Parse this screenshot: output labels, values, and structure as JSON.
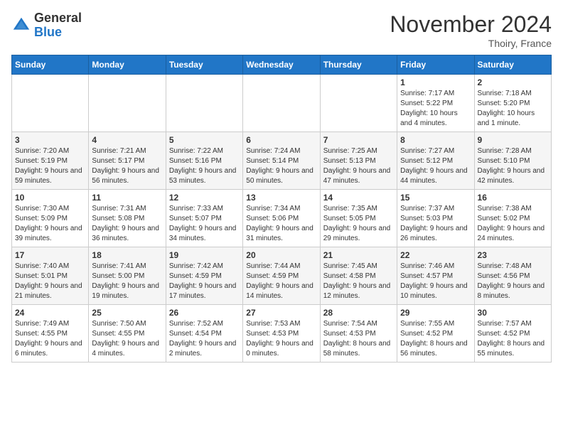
{
  "header": {
    "logo_general": "General",
    "logo_blue": "Blue",
    "month_title": "November 2024",
    "location": "Thoiry, France"
  },
  "weekdays": [
    "Sunday",
    "Monday",
    "Tuesday",
    "Wednesday",
    "Thursday",
    "Friday",
    "Saturday"
  ],
  "weeks": [
    [
      {
        "day": "",
        "info": ""
      },
      {
        "day": "",
        "info": ""
      },
      {
        "day": "",
        "info": ""
      },
      {
        "day": "",
        "info": ""
      },
      {
        "day": "",
        "info": ""
      },
      {
        "day": "1",
        "info": "Sunrise: 7:17 AM\nSunset: 5:22 PM\nDaylight: 10 hours and 4 minutes."
      },
      {
        "day": "2",
        "info": "Sunrise: 7:18 AM\nSunset: 5:20 PM\nDaylight: 10 hours and 1 minute."
      }
    ],
    [
      {
        "day": "3",
        "info": "Sunrise: 7:20 AM\nSunset: 5:19 PM\nDaylight: 9 hours and 59 minutes."
      },
      {
        "day": "4",
        "info": "Sunrise: 7:21 AM\nSunset: 5:17 PM\nDaylight: 9 hours and 56 minutes."
      },
      {
        "day": "5",
        "info": "Sunrise: 7:22 AM\nSunset: 5:16 PM\nDaylight: 9 hours and 53 minutes."
      },
      {
        "day": "6",
        "info": "Sunrise: 7:24 AM\nSunset: 5:14 PM\nDaylight: 9 hours and 50 minutes."
      },
      {
        "day": "7",
        "info": "Sunrise: 7:25 AM\nSunset: 5:13 PM\nDaylight: 9 hours and 47 minutes."
      },
      {
        "day": "8",
        "info": "Sunrise: 7:27 AM\nSunset: 5:12 PM\nDaylight: 9 hours and 44 minutes."
      },
      {
        "day": "9",
        "info": "Sunrise: 7:28 AM\nSunset: 5:10 PM\nDaylight: 9 hours and 42 minutes."
      }
    ],
    [
      {
        "day": "10",
        "info": "Sunrise: 7:30 AM\nSunset: 5:09 PM\nDaylight: 9 hours and 39 minutes."
      },
      {
        "day": "11",
        "info": "Sunrise: 7:31 AM\nSunset: 5:08 PM\nDaylight: 9 hours and 36 minutes."
      },
      {
        "day": "12",
        "info": "Sunrise: 7:33 AM\nSunset: 5:07 PM\nDaylight: 9 hours and 34 minutes."
      },
      {
        "day": "13",
        "info": "Sunrise: 7:34 AM\nSunset: 5:06 PM\nDaylight: 9 hours and 31 minutes."
      },
      {
        "day": "14",
        "info": "Sunrise: 7:35 AM\nSunset: 5:05 PM\nDaylight: 9 hours and 29 minutes."
      },
      {
        "day": "15",
        "info": "Sunrise: 7:37 AM\nSunset: 5:03 PM\nDaylight: 9 hours and 26 minutes."
      },
      {
        "day": "16",
        "info": "Sunrise: 7:38 AM\nSunset: 5:02 PM\nDaylight: 9 hours and 24 minutes."
      }
    ],
    [
      {
        "day": "17",
        "info": "Sunrise: 7:40 AM\nSunset: 5:01 PM\nDaylight: 9 hours and 21 minutes."
      },
      {
        "day": "18",
        "info": "Sunrise: 7:41 AM\nSunset: 5:00 PM\nDaylight: 9 hours and 19 minutes."
      },
      {
        "day": "19",
        "info": "Sunrise: 7:42 AM\nSunset: 4:59 PM\nDaylight: 9 hours and 17 minutes."
      },
      {
        "day": "20",
        "info": "Sunrise: 7:44 AM\nSunset: 4:59 PM\nDaylight: 9 hours and 14 minutes."
      },
      {
        "day": "21",
        "info": "Sunrise: 7:45 AM\nSunset: 4:58 PM\nDaylight: 9 hours and 12 minutes."
      },
      {
        "day": "22",
        "info": "Sunrise: 7:46 AM\nSunset: 4:57 PM\nDaylight: 9 hours and 10 minutes."
      },
      {
        "day": "23",
        "info": "Sunrise: 7:48 AM\nSunset: 4:56 PM\nDaylight: 9 hours and 8 minutes."
      }
    ],
    [
      {
        "day": "24",
        "info": "Sunrise: 7:49 AM\nSunset: 4:55 PM\nDaylight: 9 hours and 6 minutes."
      },
      {
        "day": "25",
        "info": "Sunrise: 7:50 AM\nSunset: 4:55 PM\nDaylight: 9 hours and 4 minutes."
      },
      {
        "day": "26",
        "info": "Sunrise: 7:52 AM\nSunset: 4:54 PM\nDaylight: 9 hours and 2 minutes."
      },
      {
        "day": "27",
        "info": "Sunrise: 7:53 AM\nSunset: 4:53 PM\nDaylight: 9 hours and 0 minutes."
      },
      {
        "day": "28",
        "info": "Sunrise: 7:54 AM\nSunset: 4:53 PM\nDaylight: 8 hours and 58 minutes."
      },
      {
        "day": "29",
        "info": "Sunrise: 7:55 AM\nSunset: 4:52 PM\nDaylight: 8 hours and 56 minutes."
      },
      {
        "day": "30",
        "info": "Sunrise: 7:57 AM\nSunset: 4:52 PM\nDaylight: 8 hours and 55 minutes."
      }
    ]
  ]
}
